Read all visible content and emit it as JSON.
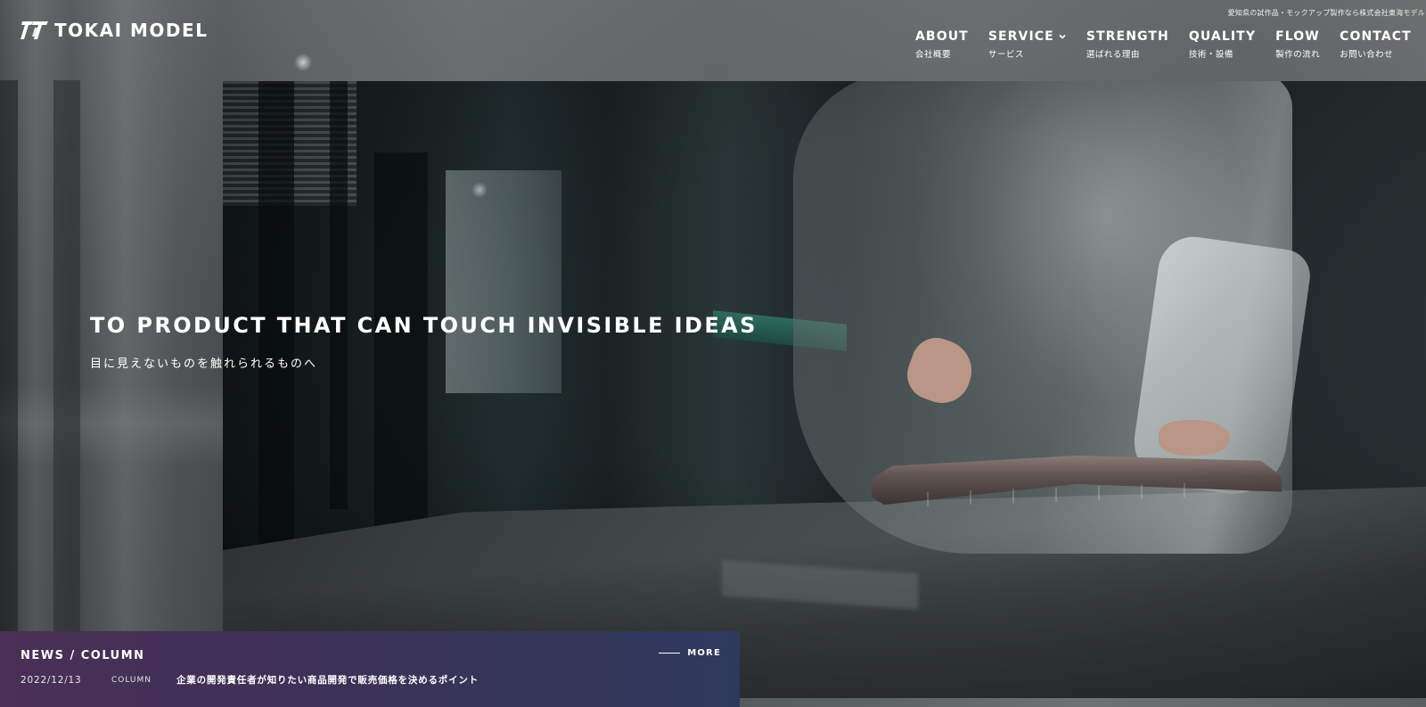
{
  "brand": {
    "logo_text": "TOKAI MODEL",
    "tagline": "愛知県の試作品・モックアップ製作なら株式会社東海モデル"
  },
  "nav": {
    "items": [
      {
        "en": "ABOUT",
        "jp": "会社概要"
      },
      {
        "en": "SERVICE",
        "jp": "サービス",
        "has_dropdown": true
      },
      {
        "en": "STRENGTH",
        "jp": "選ばれる理由"
      },
      {
        "en": "QUALITY",
        "jp": "技術・設備"
      },
      {
        "en": "FLOW",
        "jp": "製作の流れ"
      },
      {
        "en": "CONTACT",
        "jp": "お問い合わせ"
      }
    ]
  },
  "hero": {
    "title": "TO PRODUCT THAT CAN TOUCH INVISIBLE IDEAS",
    "subtitle": "目に見えないものを触れられるものへ"
  },
  "news": {
    "title": "NEWS / COLUMN",
    "more_label": "MORE",
    "items": [
      {
        "date": "2022/12/13",
        "category": "COLUMN",
        "headline": "企業の開発責任者が知りたい商品開発で販売価格を決めるポイント"
      }
    ]
  },
  "colors": {
    "news_bg_start": "#4a2f56",
    "news_bg_end": "#2e3a5c",
    "text": "#ffffff"
  },
  "icons": {
    "logo_mark": "tokai-model-logo-icon",
    "dropdown": "chevron-down-icon",
    "more_line": "line-icon"
  }
}
